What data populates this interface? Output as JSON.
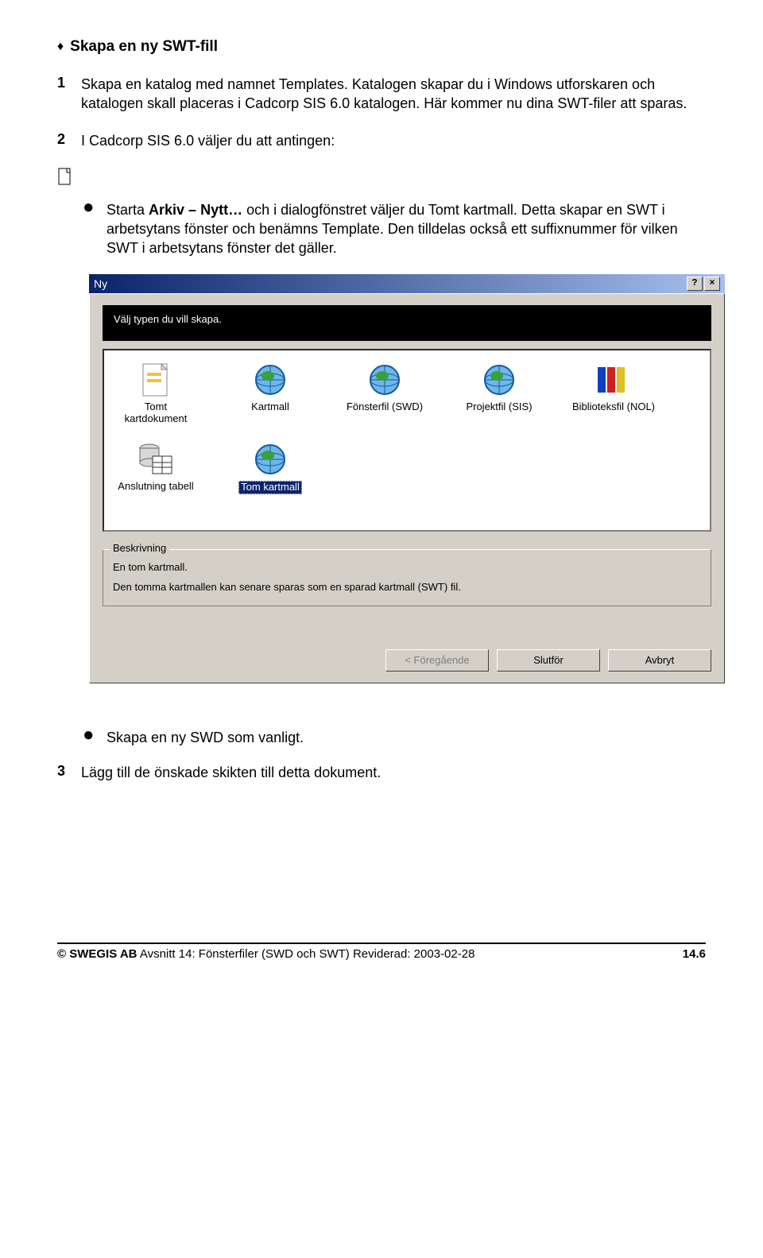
{
  "heading": "Skapa en ny SWT-fill",
  "step1": {
    "num": "1",
    "text_a": "Skapa en katalog med namnet Templates. Katalogen skapar du i Windows utforskaren och katalogen skall placeras i Cadcorp SIS 6.0 katalogen. Här kommer nu dina SWT-filer att sparas."
  },
  "step2": {
    "num": "2",
    "text": "I Cadcorp SIS 6.0 väljer du att antingen:"
  },
  "bullet_a_prefix": "Starta ",
  "bullet_a_bold": "Arkiv – Nytt…",
  "bullet_a_rest": " och i dialogfönstret väljer du Tomt kartmall. Detta skapar en SWT i arbetsytans fönster och benämns Template. Den tilldelas också ett suffixnummer för vilken SWT i arbetsytans fönster det gäller.",
  "dialog": {
    "title": "Ny",
    "help_btn": "?",
    "close_btn": "×",
    "banner": "Välj typen du vill skapa.",
    "items": [
      {
        "label": "Tomt kartdokument"
      },
      {
        "label": "Kartmall"
      },
      {
        "label": "Fönsterfil (SWD)"
      },
      {
        "label": "Projektfil (SIS)"
      },
      {
        "label": "Biblioteksfil (NOL)"
      },
      {
        "label": "Anslutning tabell"
      },
      {
        "label": "Tom kartmall"
      }
    ],
    "group_legend": "Beskrivning",
    "group_line1": "En tom kartmall.",
    "group_line2": "Den tomma kartmallen kan senare sparas som en sparad kartmall (SWT) fil.",
    "btn_prev": "< Föregående",
    "btn_finish": "Slutför",
    "btn_cancel": "Avbryt"
  },
  "bullet_b": "Skapa en ny SWD som vanligt.",
  "step3": {
    "num": "3",
    "text": "Lägg till de önskade skikten till detta dokument."
  },
  "footer": {
    "left_bold": "© SWEGIS AB",
    "left_rest": " Avsnitt 14: Fönsterfiler (SWD och SWT) Reviderad: 2003-02-28",
    "right": "14.6"
  }
}
